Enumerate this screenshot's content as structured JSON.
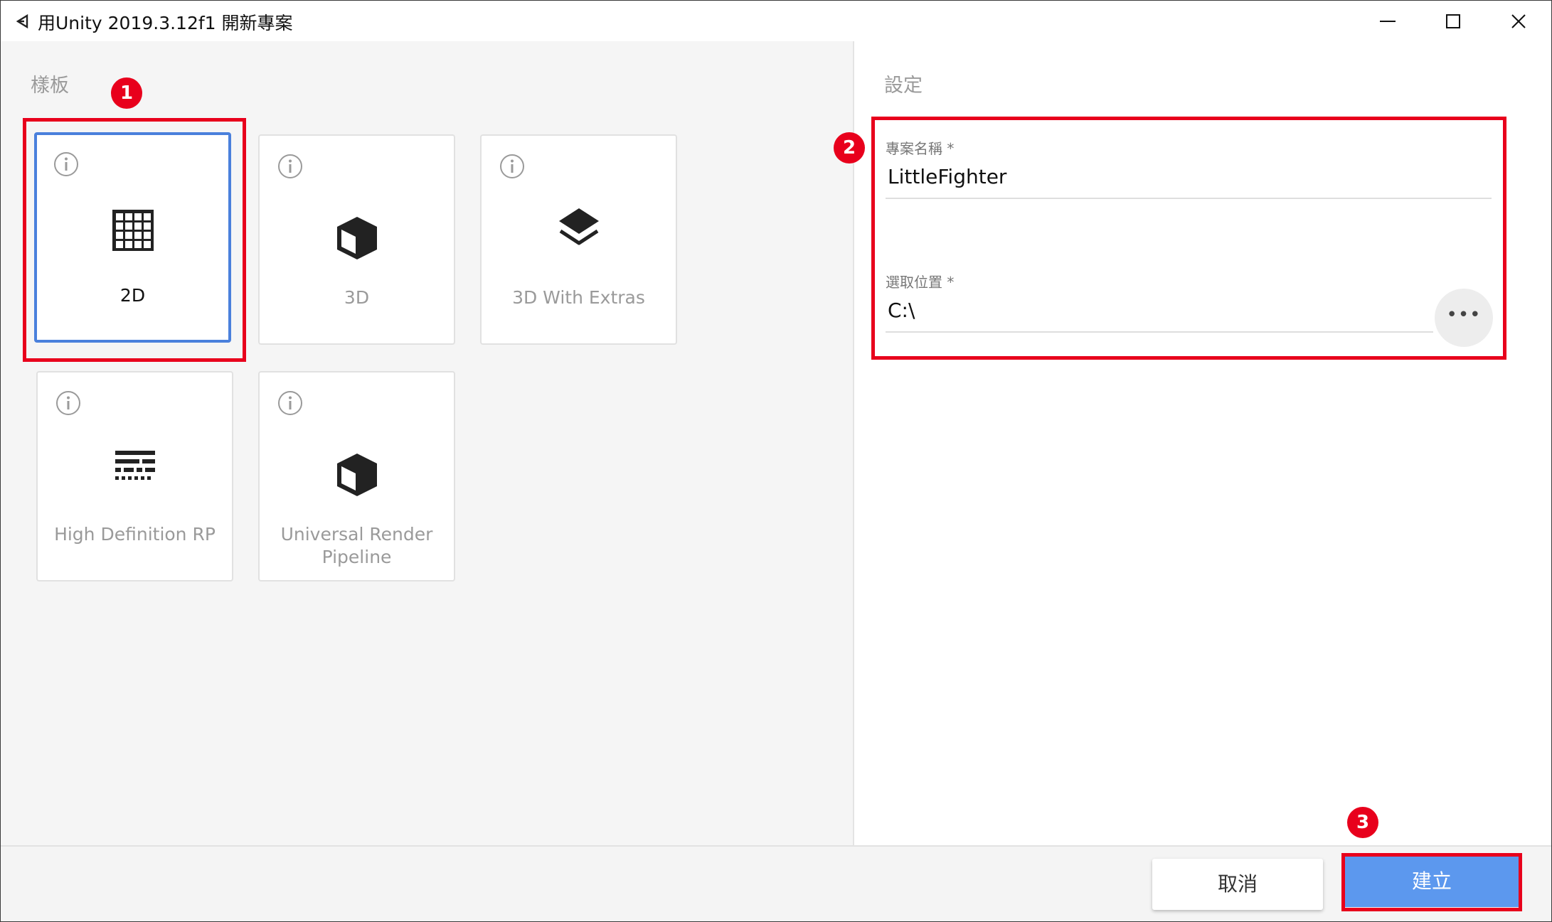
{
  "window": {
    "title": "用Unity 2019.3.12f1 開新專案"
  },
  "templates": {
    "heading": "樣板",
    "items": [
      {
        "label": "2D",
        "icon": "grid-icon",
        "selected": true
      },
      {
        "label": "3D",
        "icon": "cube-icon",
        "selected": false
      },
      {
        "label": "3D With Extras",
        "icon": "layers-icon",
        "selected": false
      },
      {
        "label": "High Definition RP",
        "icon": "hdrp-icon",
        "selected": false
      },
      {
        "label": "Universal Render Pipeline",
        "icon": "cube-icon",
        "selected": false
      }
    ]
  },
  "settings": {
    "heading": "設定",
    "project_name": {
      "label": "專案名稱 *",
      "value": "LittleFighter"
    },
    "location": {
      "label": "選取位置 *",
      "value": "C:\\",
      "browse_label": "•••"
    }
  },
  "footer": {
    "cancel_label": "取消",
    "create_label": "建立"
  },
  "annotations": {
    "badge_1": "1",
    "badge_2": "2",
    "badge_3": "3"
  },
  "colors": {
    "selection_border": "#4a80dc",
    "create_button": "#5c98ee",
    "annotation_red": "#e8001c"
  }
}
